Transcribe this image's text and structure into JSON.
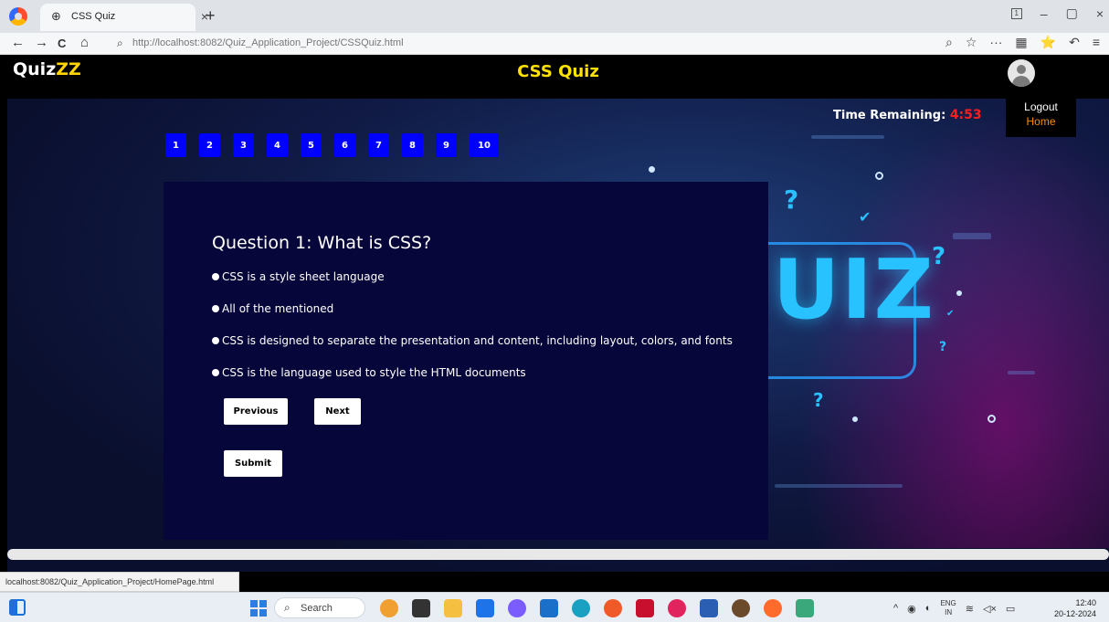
{
  "browser": {
    "tab_title": "CSS Quiz",
    "tab_close": "×",
    "new_tab": "+",
    "url": "http://localhost:8082/Quiz_Application_Project/CSSQuiz.html",
    "status_url": "localhost:8082/Quiz_Application_Project/HomePage.html",
    "nav_back": "←",
    "nav_forward": "→",
    "nav_reload": "C",
    "nav_home": "⌂",
    "window_controls": [
      "1",
      "–",
      "▢",
      "×"
    ],
    "nav_right_icons": [
      "⌕",
      "☆",
      "···",
      "▦",
      "⭐",
      "↶",
      "≡"
    ]
  },
  "app": {
    "logo_main": "Quiz",
    "logo_accent": "ZZ",
    "title": "CSS Quiz",
    "menu": {
      "logout": "Logout",
      "home": "Home"
    },
    "timer": {
      "label": "Time Remaining: ",
      "value": "4:53"
    },
    "question_numbers": [
      "1",
      "2",
      "3",
      "4",
      "5",
      "6",
      "7",
      "8",
      "9",
      "10"
    ],
    "question": "Question 1: What is CSS?",
    "options": [
      "CSS is a style sheet language",
      "All of the mentioned",
      "CSS is designed to separate the presentation and content, including layout, colors, and fonts",
      "CSS is the language used to style the HTML documents"
    ],
    "buttons": {
      "previous": "Previous",
      "next": "Next",
      "submit": "Submit"
    },
    "background_text": "UIZ",
    "colors": {
      "accent_yellow": "#ffe100",
      "timer_red": "#ff1e1e",
      "qnum_blue": "#0000ff",
      "panel": "#07063a"
    }
  },
  "taskbar": {
    "search_label": "Search",
    "lang": [
      "ENG",
      "IN"
    ],
    "time": "12:40",
    "date": "20-12-2024"
  }
}
